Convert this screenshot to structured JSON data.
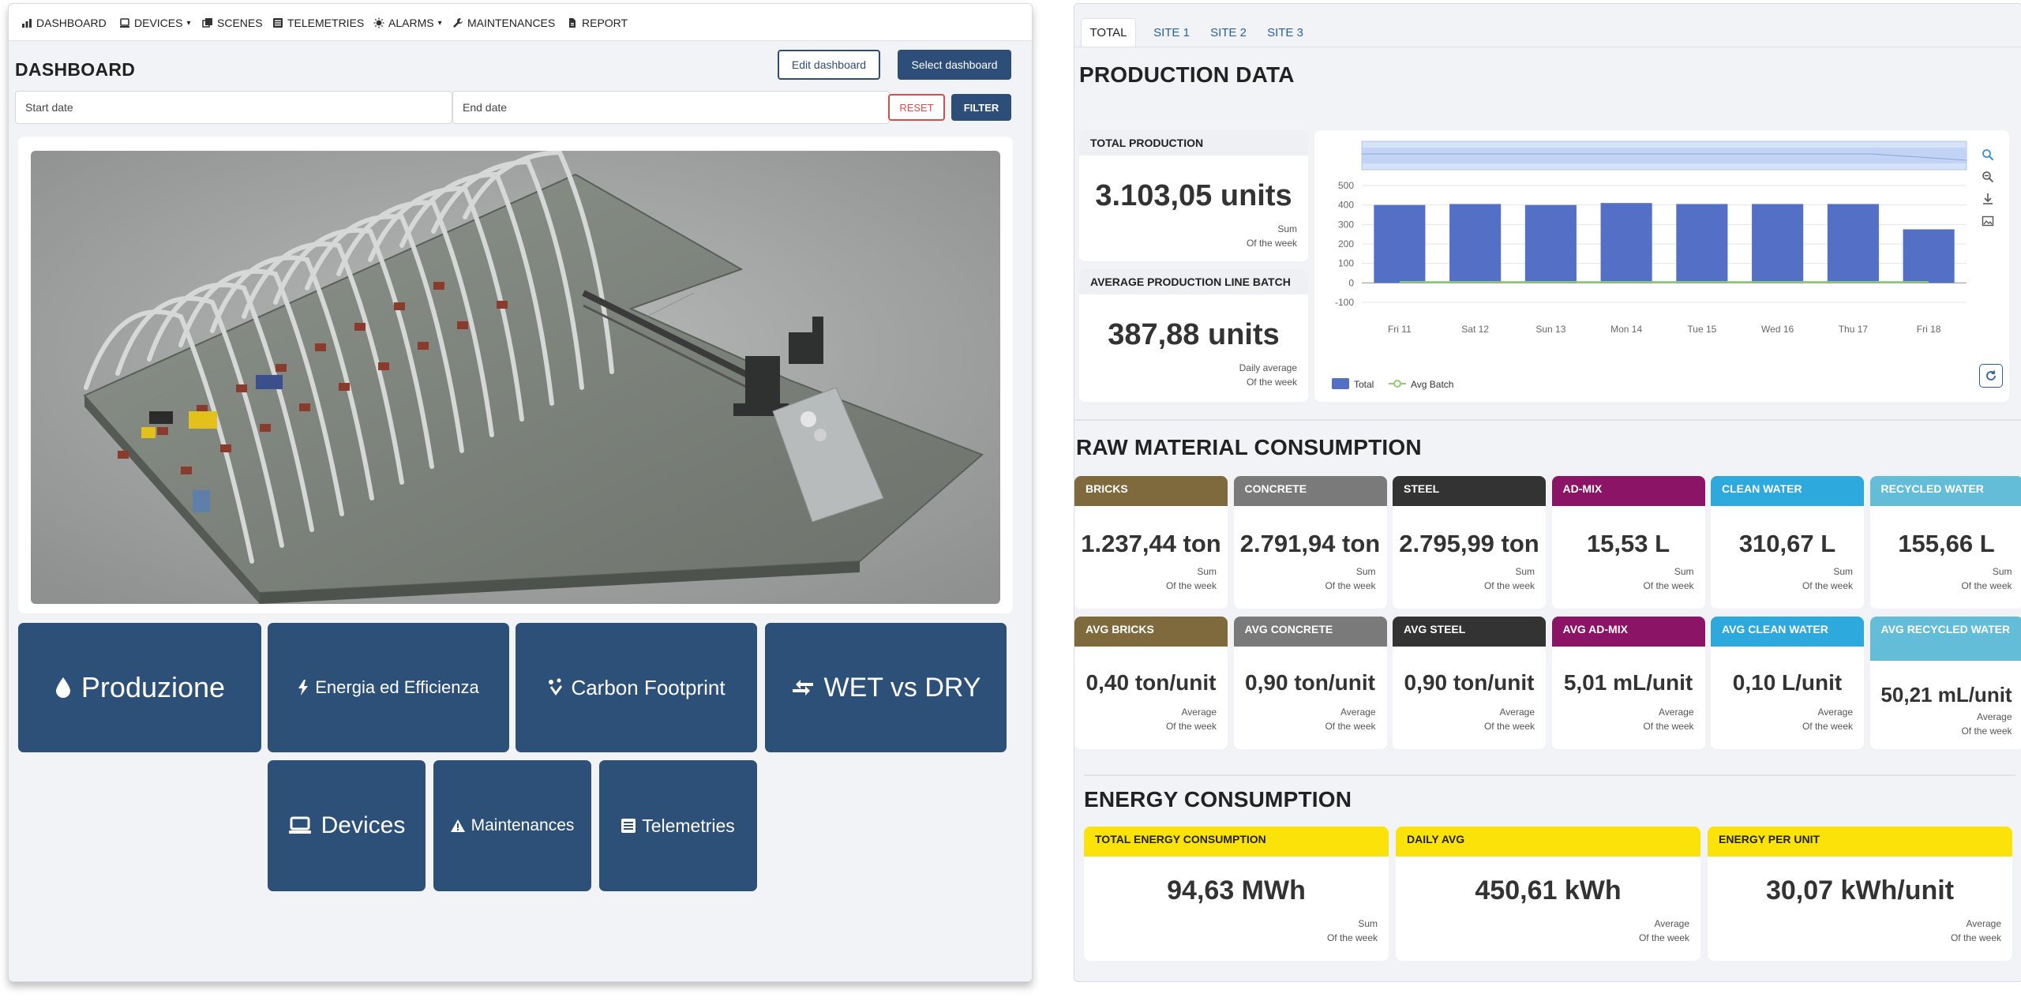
{
  "left_panel": {
    "nav": [
      {
        "label": "DASHBOARD",
        "icon": "chart-bars-icon"
      },
      {
        "label": "DEVICES",
        "icon": "device-icon",
        "caret": "▾"
      },
      {
        "label": "SCENES",
        "icon": "scenes-icon"
      },
      {
        "label": "TELEMETRIES",
        "icon": "list-icon"
      },
      {
        "label": "ALARMS",
        "icon": "alarm-icon",
        "caret": "▾"
      },
      {
        "label": "MAINTENANCES",
        "icon": "wrench-icon"
      },
      {
        "label": "REPORT",
        "icon": "file-icon"
      }
    ],
    "page_title": "DASHBOARD",
    "edit_button": "Edit dashboard",
    "select_button": "Select dashboard",
    "start_date_placeholder": "Start date",
    "end_date_placeholder": "End date",
    "reset_button": "RESET",
    "filter_button": "FILTER",
    "tiles": [
      {
        "label": "Produzione",
        "icon": "drop-icon"
      },
      {
        "label": "Energia ed Efficienza",
        "icon": "bolt-icon"
      },
      {
        "label": "Carbon Footprint",
        "icon": "footprint-icon"
      },
      {
        "label": "WET vs DRY",
        "icon": "compare-arrows-icon"
      },
      {
        "label": "Devices",
        "icon": "laptop-icon"
      },
      {
        "label": "Maintenances",
        "icon": "warning-icon"
      },
      {
        "label": "Telemetries",
        "icon": "list-icon"
      }
    ],
    "colors": {
      "primary": "#2d5078",
      "reset": "#dd4b4b",
      "background": "#f1f3f6"
    }
  },
  "right_panel": {
    "tabs": [
      "TOTAL",
      "SITE 1",
      "SITE 2",
      "SITE 3"
    ],
    "active_tab": "TOTAL",
    "production": {
      "title": "PRODUCTION DATA",
      "total": {
        "head": "TOTAL PRODUCTION",
        "value": "3.103,05 units",
        "sub1": "Sum",
        "sub2": "Of the week"
      },
      "average": {
        "head": "AVERAGE PRODUCTION LINE BATCH",
        "value": "387,88 units",
        "sub1": "Daily average",
        "sub2": "Of the week"
      }
    },
    "chart_data": {
      "type": "bar",
      "categories": [
        "Fri 11",
        "Sat 12",
        "Sun 13",
        "Mon 14",
        "Tue 15",
        "Wed 16",
        "Thu 17",
        "Fri 18"
      ],
      "series": [
        {
          "name": "Total",
          "type": "bar",
          "color": "#5470c6",
          "values": [
            400,
            405,
            400,
            410,
            405,
            405,
            405,
            275
          ]
        },
        {
          "name": "Avg Batch",
          "type": "line",
          "color": "#91cc75",
          "values": [
            5,
            5,
            5,
            5,
            5,
            5,
            5,
            5
          ]
        }
      ],
      "y_ticks": [
        "500",
        "400",
        "300",
        "200",
        "100",
        "0",
        "-100"
      ],
      "ylim": [
        -100,
        500
      ],
      "legend_position": "bottom-left",
      "grid": true
    },
    "raw_material": {
      "title": "RAW MATERIAL CONSUMPTION",
      "sum_cards": [
        {
          "head": "BRICKS",
          "value": "1.237,44 ton",
          "sub1": "Sum",
          "sub2": "Of the week",
          "color": "#7f6a3e",
          "text": "#ffffff"
        },
        {
          "head": "CONCRETE",
          "value": "2.791,94 ton",
          "sub1": "Sum",
          "sub2": "Of the week",
          "color": "#7a7a7a",
          "text": "#ffffff"
        },
        {
          "head": "STEEL",
          "value": "2.795,99 ton",
          "sub1": "Sum",
          "sub2": "Of the week",
          "color": "#333333",
          "text": "#ffffff"
        },
        {
          "head": "AD-MIX",
          "value": "15,53 L",
          "sub1": "Sum",
          "sub2": "Of the week",
          "color": "#8c1466",
          "text": "#ffffff"
        },
        {
          "head": "CLEAN WATER",
          "value": "310,67 L",
          "sub1": "Sum",
          "sub2": "Of the week",
          "color": "#2ea9dd",
          "text": "#ffffff"
        },
        {
          "head": "RECYCLED WATER",
          "value": "155,66 L",
          "sub1": "Sum",
          "sub2": "Of the week",
          "color": "#63bdd8",
          "text": "#ffffff"
        }
      ],
      "avg_cards": [
        {
          "head": "AVG BRICKS",
          "value": "0,40 ton/unit",
          "sub1": "Average",
          "sub2": "Of the week",
          "color": "#7f6a3e",
          "text": "#ffffff"
        },
        {
          "head": "AVG CONCRETE",
          "value": "0,90 ton/unit",
          "sub1": "Average",
          "sub2": "Of the week",
          "color": "#7a7a7a",
          "text": "#ffffff"
        },
        {
          "head": "AVG STEEL",
          "value": "0,90 ton/unit",
          "sub1": "Average",
          "sub2": "Of the week",
          "color": "#333333",
          "text": "#ffffff"
        },
        {
          "head": "AVG AD-MIX",
          "value": "5,01 mL/unit",
          "sub1": "Average",
          "sub2": "Of the week",
          "color": "#8c1466",
          "text": "#ffffff"
        },
        {
          "head": "AVG CLEAN WATER",
          "value": "0,10 L/unit",
          "sub1": "Average",
          "sub2": "Of the week",
          "color": "#2ea9dd",
          "text": "#ffffff"
        },
        {
          "head": "AVG RECYCLED WATER",
          "value": "50,21 mL/unit",
          "sub1": "Average",
          "sub2": "Of the week",
          "color": "#63bdd8",
          "text": "#ffffff"
        }
      ]
    },
    "energy": {
      "title": "ENERGY CONSUMPTION",
      "cards": [
        {
          "head": "TOTAL ENERGY CONSUMPTION",
          "value": "94,63 MWh",
          "sub1": "Sum",
          "sub2": "Of the week"
        },
        {
          "head": "DAILY AVG",
          "value": "450,61 kWh",
          "sub1": "Average",
          "sub2": "Of the week"
        },
        {
          "head": "ENERGY PER UNIT",
          "value": "30,07 kWh/unit",
          "sub1": "Average",
          "sub2": "Of the week"
        }
      ],
      "color": "#fbe30a"
    }
  }
}
